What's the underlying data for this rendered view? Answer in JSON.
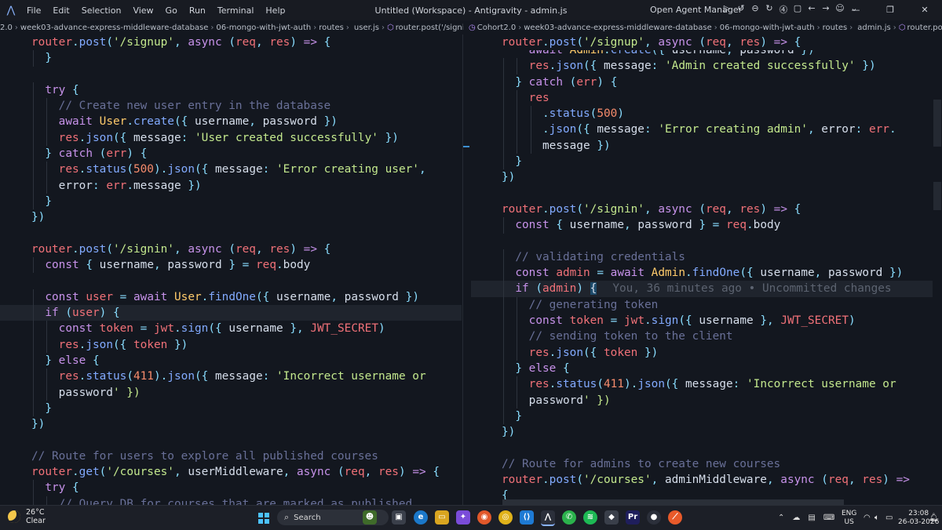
{
  "titlebar": {
    "menu": [
      "File",
      "Edit",
      "Selection",
      "View",
      "Go",
      "Run",
      "Terminal",
      "Help"
    ],
    "window_title": "Untitled (Workspace) - Antigravity - admin.js",
    "agent_manager": "Open Agent Manager",
    "controls": [
      "—",
      "❐",
      "✕"
    ]
  },
  "breadcrumbs_left": [
    "2.0",
    "week03-advance-express-middleware-database",
    "06-mongo-with-jwt-auth",
    "routes",
    "user.js",
    "router.post('/signin') callback"
  ],
  "breadcrumbs_right": [
    "Cohort2.0",
    "week03-advance-express-middleware-database",
    "06-mongo-with-jwt-auth",
    "routes",
    "admin.js",
    "router.post('/signin') ca"
  ],
  "editor_left": {
    "lines": [
      "router.post('/signup', async (req, res) => {",
      "  }",
      "",
      "  try {",
      "    // Create new user entry in the database",
      "    await User.create({ username, password })",
      "    res.json({ message: 'User created successfully' })",
      "  } catch (err) {",
      "    res.status(500).json({ message: 'Error creating user',",
      "    error: err.message })",
      "  }",
      "})",
      "",
      "router.post('/signin', async (req, res) => {",
      "  const { username, password } = req.body",
      "",
      "  const user = await User.findOne({ username, password })",
      "  if (user) {",
      "    const token = jwt.sign({ username }, JWT_SECRET)",
      "    res.json({ token })",
      "  } else {",
      "    res.status(411).json({ message: 'Incorrect username or",
      "    password' })",
      "  }",
      "})",
      "",
      "// Route for users to explore all published courses",
      "router.get('/courses', userMiddleware, async (req, res) => {",
      "  try {",
      "    // Query DB for courses that are marked as published"
    ]
  },
  "editor_right": {
    "lines": [
      "router.post('/signup', async (req, res) => {",
      "    res.json({ message: 'Admin created successfully' })",
      "  } catch (err) {",
      "    res",
      "      .status(500)",
      "      .json({ message: 'Error creating admin', error: err.",
      "      message })",
      "  }",
      "})",
      "",
      "router.post('/signin', async (req, res) => {",
      "  const { username, password } = req.body",
      "",
      "  // validating credentials",
      "  const admin = await Admin.findOne({ username, password })",
      "  if (admin) {",
      "    // generating token",
      "    const token = jwt.sign({ username }, JWT_SECRET)",
      "    // sending token to the client",
      "    res.json({ token })",
      "  } else {",
      "    res.status(411).json({ message: 'Incorrect username or",
      "    password' })",
      "  }",
      "})",
      "",
      "// Route for admins to create new courses",
      "router.post('/courses', adminMiddleware, async (req, res) =>",
      "{"
    ],
    "partial_top_line": "    await Admin.create({ username, password })",
    "blame": "You, 36 minutes ago • Uncommitted changes"
  },
  "taskbar": {
    "weather_temp": "26°C",
    "weather_desc": "Clear",
    "search_placeholder": "Search",
    "lang_line1": "ENG",
    "lang_line2": "US",
    "time": "23:08",
    "date": "26-03-2026"
  },
  "colors": {
    "background": "#13171f",
    "keyword": "#c792ea",
    "function": "#82aaff",
    "string": "#c3e88d",
    "variable": "#f07178",
    "class": "#ffcb6b",
    "number": "#f78c6c",
    "comment": "#697098"
  }
}
